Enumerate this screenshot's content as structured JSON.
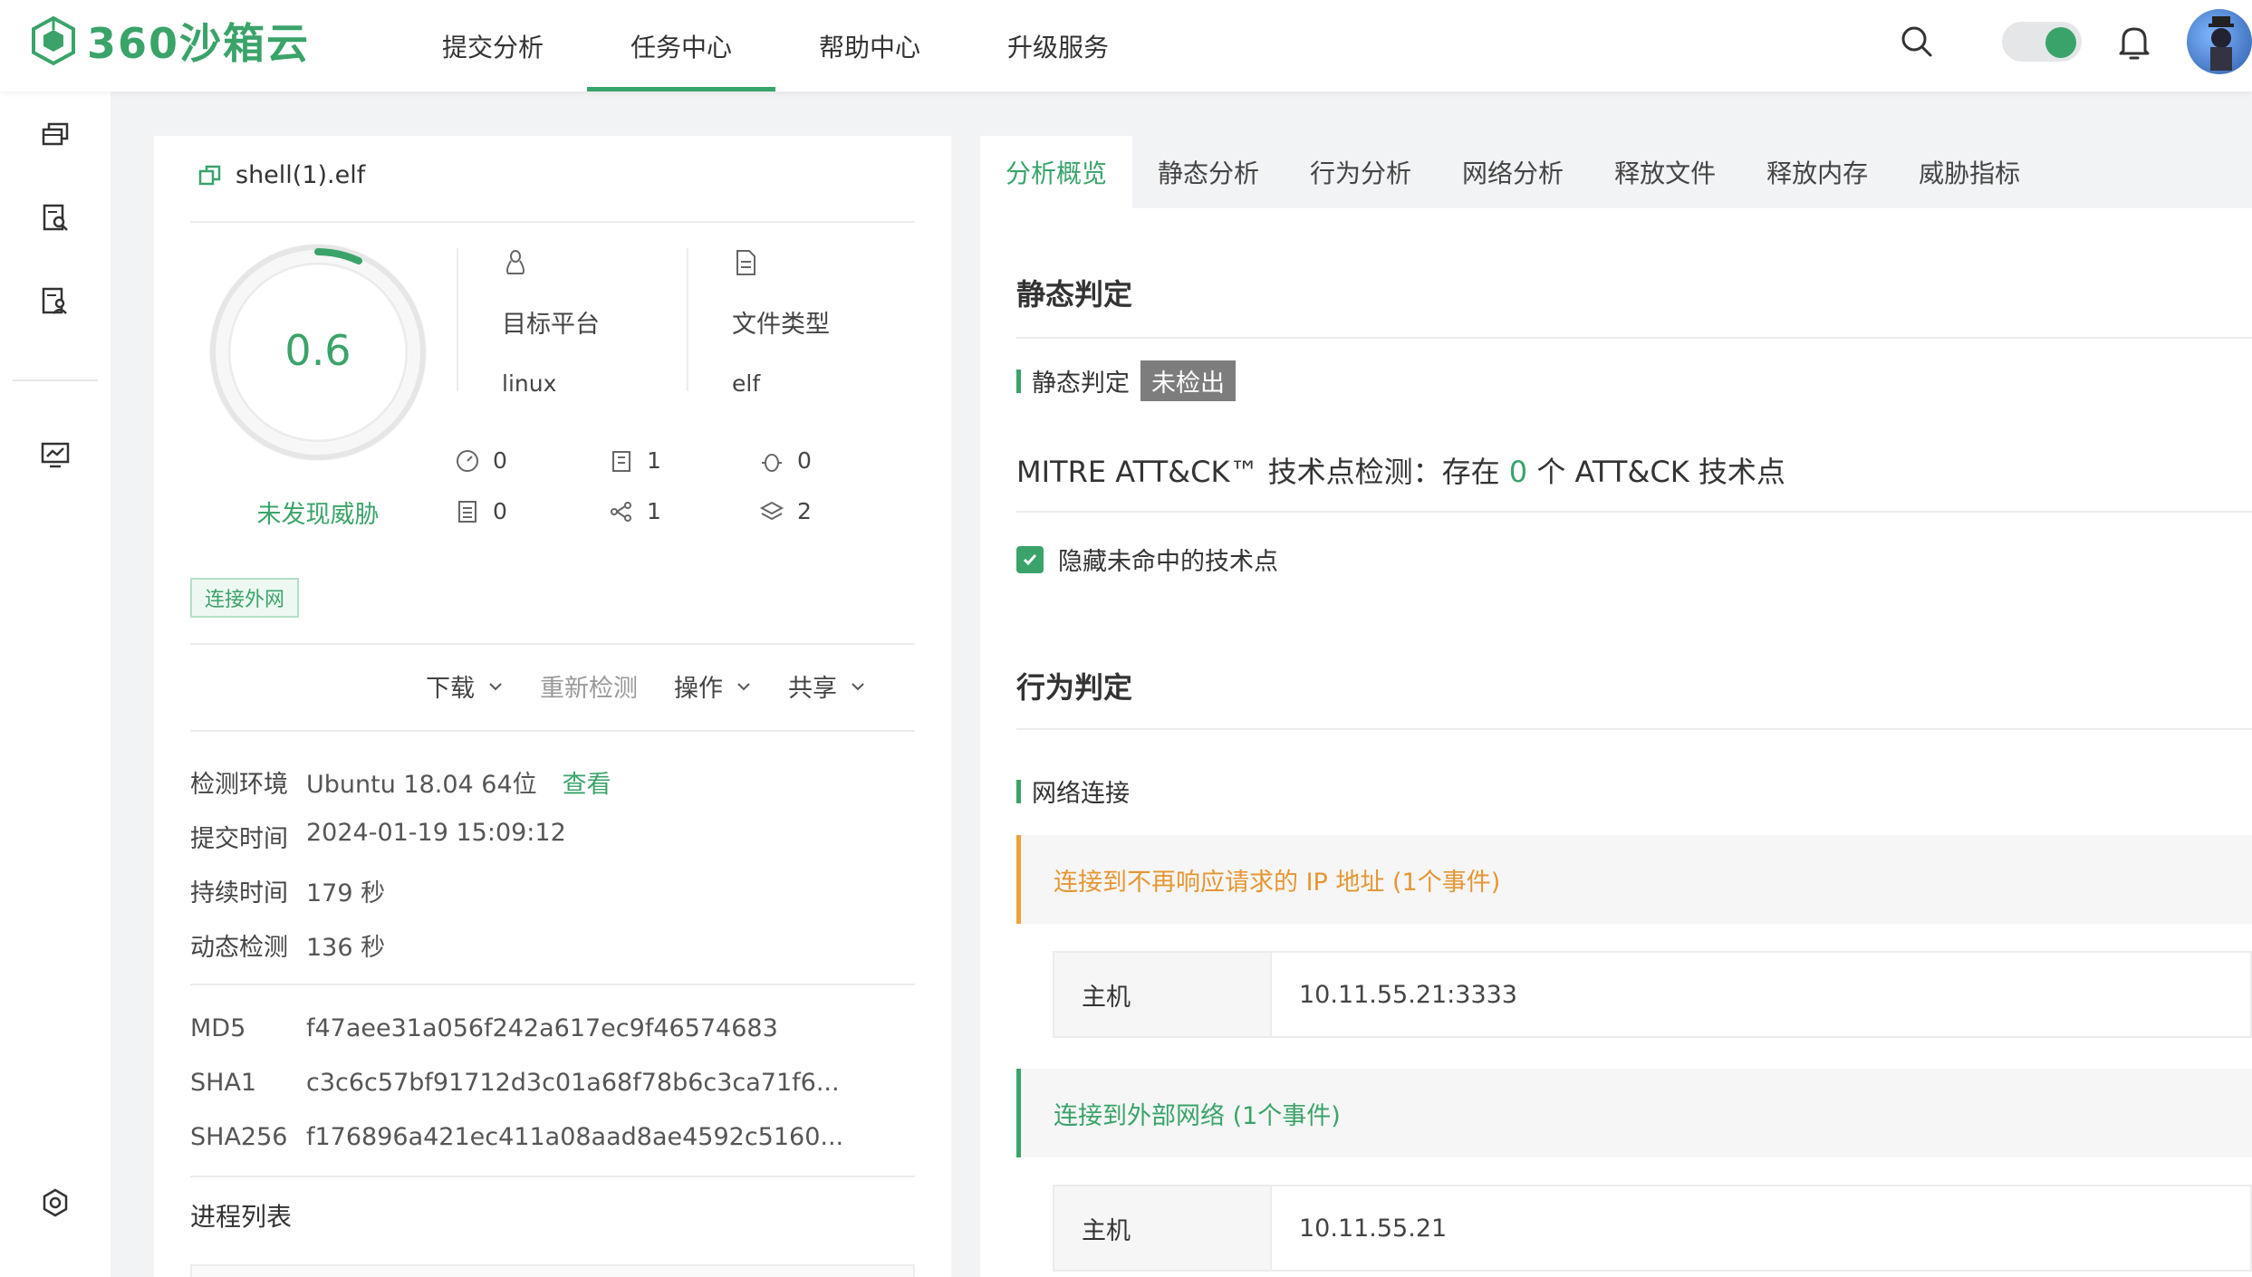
{
  "brand": {
    "logo_text": "360沙箱云"
  },
  "nav": [
    "提交分析",
    "任务中心",
    "帮助中心",
    "升级服务"
  ],
  "file": {
    "name": "shell(1).elf",
    "score": "0.6",
    "verdict": "未发现威胁",
    "platform_label": "目标平台",
    "platform_value": "linux",
    "filetype_label": "文件类型",
    "filetype_value": "elf",
    "stats": [
      "0",
      "1",
      "0",
      "0",
      "1",
      "2"
    ],
    "tag": "连接外网"
  },
  "actions": {
    "download": "下载",
    "recheck": "重新检测",
    "operate": "操作",
    "share": "共享"
  },
  "info": {
    "env_label": "检测环境",
    "env_value": "Ubuntu 18.04 64位",
    "env_link": "查看",
    "submit_label": "提交时间",
    "submit_value": "2024-01-19 15:09:12",
    "duration_label": "持续时间",
    "duration_value": "179 秒",
    "dynamic_label": "动态检测",
    "dynamic_value": "136 秒"
  },
  "hashes": {
    "md5_label": "MD5",
    "md5": "f47aee31a056f242a617ec9f46574683",
    "sha1_label": "SHA1",
    "sha1": "c3c6c57bf91712d3c01a68f78b6c3ca71f6...",
    "sha256_label": "SHA256",
    "sha256": "f176896a421ec411a08aad8ae4592c5160..."
  },
  "process_title": "进程列表",
  "tabs": [
    "分析概览",
    "静态分析",
    "行为分析",
    "网络分析",
    "释放文件",
    "释放内存",
    "威胁指标"
  ],
  "overview": {
    "static_title": "静态判定",
    "static_sub": "静态判定",
    "static_badge": "未检出",
    "mitre_prefix": "MITRE ATT&CK™ 技术点检测：存在 ",
    "mitre_count": "0",
    "mitre_suffix": " 个 ATT&CK 技术点",
    "hide_label": "隐藏未命中的技术点",
    "behavior_title": "行为判定",
    "network_sub": "网络连接",
    "event1": "连接到不再响应请求的 IP 地址 (1个事件)",
    "host_label": "主机",
    "event1_host": "10.11.55.21:3333",
    "event2": "连接到外部网络 (1个事件)",
    "event2_host": "10.11.55.21"
  },
  "colors": {
    "accent": "#3aa36a",
    "warning": "#e69633"
  }
}
